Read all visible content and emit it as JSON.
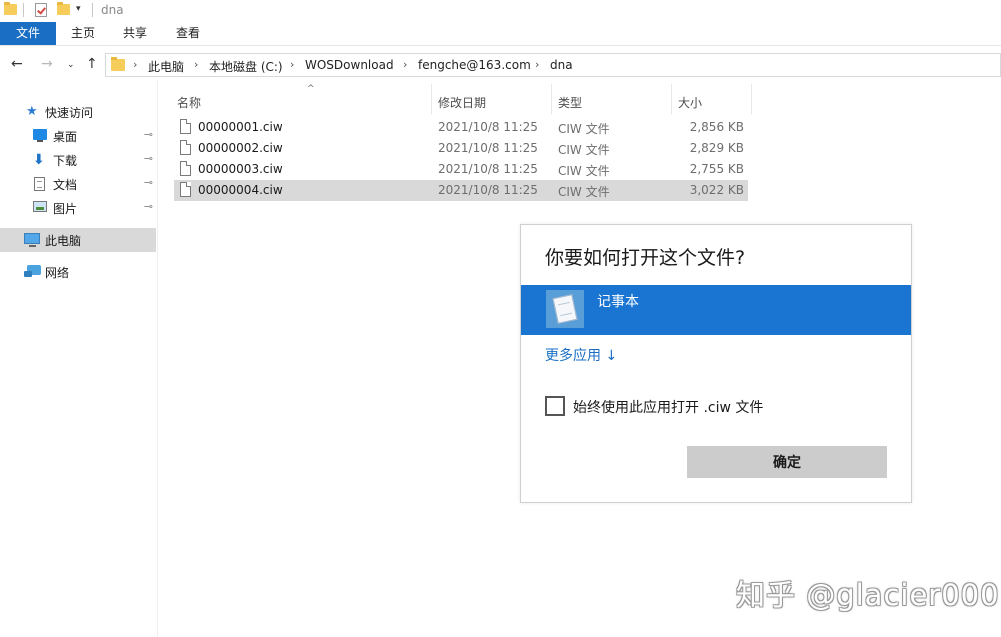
{
  "window": {
    "title": "dna",
    "quick_access_dropdown": "▾"
  },
  "ribbon": {
    "tabs": [
      "文件",
      "主页",
      "共享",
      "查看"
    ]
  },
  "nav": {
    "back": "←",
    "forward": "→",
    "recent": "⌄",
    "up": "↑"
  },
  "address": {
    "breadcrumbs": [
      "此电脑",
      "本地磁盘 (C:)",
      "WOSDownload",
      "fengche@163.com",
      "dna"
    ],
    "separator": "›"
  },
  "sidebar": {
    "quick_access": "快速访问",
    "items": [
      {
        "label": "桌面",
        "icon": "desktop-icon",
        "pinned": true
      },
      {
        "label": "下载",
        "icon": "download-icon",
        "pinned": true
      },
      {
        "label": "文档",
        "icon": "documents-icon",
        "pinned": true
      },
      {
        "label": "图片",
        "icon": "pictures-icon",
        "pinned": true
      }
    ],
    "this_pc": "此电脑",
    "network": "网络",
    "pin_glyph": "📌"
  },
  "file_list": {
    "columns": [
      "名称",
      "修改日期",
      "类型",
      "大小"
    ],
    "sort_indicator": "^",
    "rows": [
      {
        "name": "00000001.ciw",
        "date": "2021/10/8 11:25",
        "type": "CIW 文件",
        "size": "2,856 KB"
      },
      {
        "name": "00000002.ciw",
        "date": "2021/10/8 11:25",
        "type": "CIW 文件",
        "size": "2,829 KB"
      },
      {
        "name": "00000003.ciw",
        "date": "2021/10/8 11:25",
        "type": "CIW 文件",
        "size": "2,755 KB"
      },
      {
        "name": "00000004.ciw",
        "date": "2021/10/8 11:25",
        "type": "CIW 文件",
        "size": "3,022 KB"
      }
    ],
    "selected_index": 3
  },
  "dialog": {
    "title": "你要如何打开这个文件?",
    "app_name": "记事本",
    "more_apps": "更多应用 ↓",
    "always_use": "始终使用此应用打开 .ciw 文件",
    "always_use_checked": false,
    "ok": "确定"
  },
  "watermark": "知乎 @glacier000",
  "colors": {
    "accent": "#1a6fc4",
    "selection_blue": "#1a75d2",
    "row_selected": "#d9d9d9",
    "folder_yellow": "#f6cd5a"
  }
}
